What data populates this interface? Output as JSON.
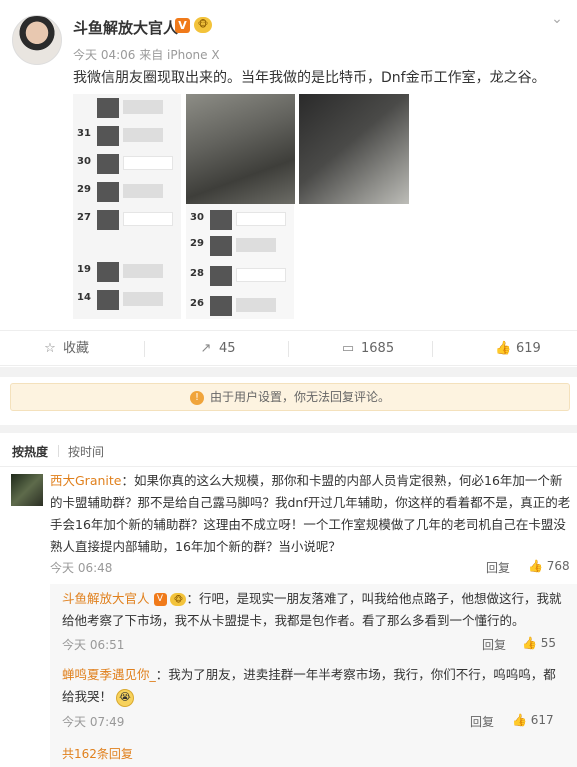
{
  "post": {
    "username": "斗鱼解放大官人",
    "verified_badge": "V",
    "level_badge": "🐵",
    "meta": "今天 04:06 来自 iPhone X",
    "text": "我微信朋友圈现取出来的。当年我做的是比特币，Dnf金币工作室，龙之谷。",
    "menu_icon": "chevron-down-icon",
    "images": [
      {
        "label": "moments-screenshot-1",
        "rows": [
          "31",
          "30",
          "29",
          "27",
          "19",
          "14"
        ]
      },
      {
        "label": "studio-photo-room"
      },
      {
        "label": "studio-photo-machines"
      },
      {
        "label": "moments-screenshot-2",
        "rows": [
          "30",
          "29",
          "28",
          "26"
        ]
      }
    ]
  },
  "actions": {
    "favorite": "收藏",
    "repost_count": "45",
    "comment_count": "1685",
    "like_count": "619"
  },
  "notice": {
    "text": "由于用户设置，你无法回复评论。"
  },
  "sort": {
    "hot": "按热度",
    "time": "按时间"
  },
  "comments": [
    {
      "name": "西大Granite",
      "text": "：如果你真的这么大规模，那你和卡盟的内部人员肯定很熟，何必16年加一个新的卡盟辅助群？那不是给自己露马脚吗？我dnf开过几年辅助，你这样的看着都不是，真正的老手会16年加个新的辅助群？这理由不成立呀！一个工作室规模做了几年的老司机自己在卡盟没熟人直接提内部辅助，16年加个新的群？当小说呢？",
      "time": "今天 06:48",
      "reply": "回复",
      "likes": "768"
    }
  ],
  "replies": [
    {
      "name": "斗鱼解放大官人",
      "text": "：行吧，是现实一朋友落难了，叫我给他点路子，他想做这行，我就给他考察了下市场，我不从卡盟提卡，我都是包作者。看了那么多看到一个懂行的。",
      "time": "今天 06:51",
      "reply": "回复",
      "likes": "55"
    },
    {
      "name": "蝉鸣夏季遇见你_",
      "text": "：我为了朋友，进卖挂群一年半考察市场，我行，你们不行，呜呜呜，都给我哭！",
      "time": "今天 07:49",
      "reply": "回复",
      "likes": "617"
    }
  ],
  "more_replies": "共162条回复"
}
